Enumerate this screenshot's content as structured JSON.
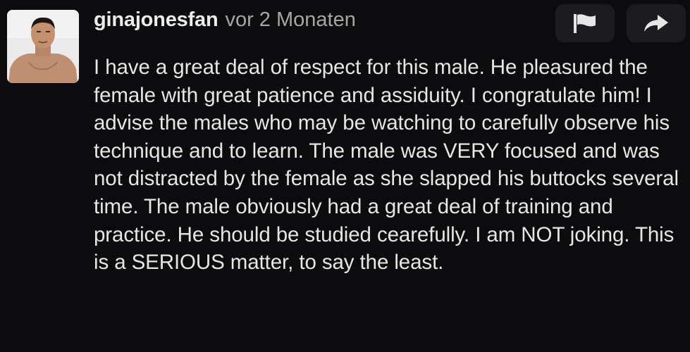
{
  "comment": {
    "author": "ginajonesfan",
    "timestamp": "vor 2 Monaten",
    "text": "I have a great deal of respect for this male. He pleasured the female with great patience and assiduity. I congratulate him! I advise the males who may be watching to carefully observe his technique and to learn. The male was VERY focused and was not distracted by the female as she slapped his buttocks several time. The male obviously had a great deal of training and practice. He should be studied cearefully. I am NOT joking. This is a SERIOUS matter, to say the least.",
    "avatar_icon": "user-avatar-photo",
    "actions": [
      {
        "name": "flag",
        "icon": "flag-icon"
      },
      {
        "name": "share",
        "icon": "share-icon"
      }
    ]
  },
  "colors": {
    "background": "#0c0b0e",
    "button_bg": "#1c1b1f",
    "text": "#e6e6e6",
    "muted": "#a6a6a6"
  }
}
